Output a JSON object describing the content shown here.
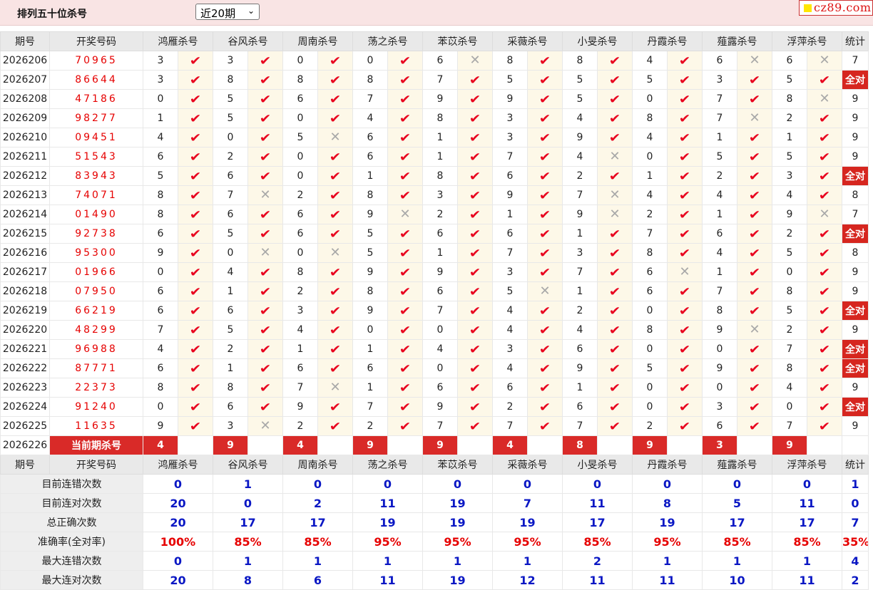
{
  "header": {
    "title": "排列五十位杀号",
    "period_select": "近20期",
    "logo_text": "cz89.com"
  },
  "columns": {
    "period": "期号",
    "draw": "开奖号码",
    "experts": [
      "鸿雁杀号",
      "谷风杀号",
      "周南杀号",
      "荡之杀号",
      "苯苡杀号",
      "采薇杀号",
      "小旻杀号",
      "丹霞杀号",
      "薤露杀号",
      "浮萍杀号"
    ],
    "stat": "统计"
  },
  "rows": [
    {
      "period": "2026206",
      "draw": "70965",
      "picks": [
        [
          3,
          1
        ],
        [
          3,
          1
        ],
        [
          0,
          1
        ],
        [
          0,
          1
        ],
        [
          6,
          0
        ],
        [
          8,
          1
        ],
        [
          8,
          1
        ],
        [
          4,
          1
        ],
        [
          6,
          0
        ],
        [
          6,
          0
        ]
      ],
      "stat": "7"
    },
    {
      "period": "2026207",
      "draw": "86644",
      "picks": [
        [
          3,
          1
        ],
        [
          8,
          1
        ],
        [
          8,
          1
        ],
        [
          8,
          1
        ],
        [
          7,
          1
        ],
        [
          5,
          1
        ],
        [
          5,
          1
        ],
        [
          5,
          1
        ],
        [
          3,
          1
        ],
        [
          5,
          1
        ]
      ],
      "stat": "全对"
    },
    {
      "period": "2026208",
      "draw": "47186",
      "picks": [
        [
          0,
          1
        ],
        [
          5,
          1
        ],
        [
          6,
          1
        ],
        [
          7,
          1
        ],
        [
          9,
          1
        ],
        [
          9,
          1
        ],
        [
          5,
          1
        ],
        [
          0,
          1
        ],
        [
          7,
          1
        ],
        [
          8,
          0
        ]
      ],
      "stat": "9"
    },
    {
      "period": "2026209",
      "draw": "98277",
      "picks": [
        [
          1,
          1
        ],
        [
          5,
          1
        ],
        [
          0,
          1
        ],
        [
          4,
          1
        ],
        [
          8,
          1
        ],
        [
          3,
          1
        ],
        [
          4,
          1
        ],
        [
          8,
          1
        ],
        [
          7,
          0
        ],
        [
          2,
          1
        ]
      ],
      "stat": "9"
    },
    {
      "period": "2026210",
      "draw": "09451",
      "picks": [
        [
          4,
          1
        ],
        [
          0,
          1
        ],
        [
          5,
          0
        ],
        [
          6,
          1
        ],
        [
          1,
          1
        ],
        [
          3,
          1
        ],
        [
          9,
          1
        ],
        [
          4,
          1
        ],
        [
          1,
          1
        ],
        [
          1,
          1
        ]
      ],
      "stat": "9"
    },
    {
      "period": "2026211",
      "draw": "51543",
      "picks": [
        [
          6,
          1
        ],
        [
          2,
          1
        ],
        [
          0,
          1
        ],
        [
          6,
          1
        ],
        [
          1,
          1
        ],
        [
          7,
          1
        ],
        [
          4,
          0
        ],
        [
          0,
          1
        ],
        [
          5,
          1
        ],
        [
          5,
          1
        ]
      ],
      "stat": "9"
    },
    {
      "period": "2026212",
      "draw": "83943",
      "picks": [
        [
          5,
          1
        ],
        [
          6,
          1
        ],
        [
          0,
          1
        ],
        [
          1,
          1
        ],
        [
          8,
          1
        ],
        [
          6,
          1
        ],
        [
          2,
          1
        ],
        [
          1,
          1
        ],
        [
          2,
          1
        ],
        [
          3,
          1
        ]
      ],
      "stat": "全对"
    },
    {
      "period": "2026213",
      "draw": "74071",
      "picks": [
        [
          8,
          1
        ],
        [
          7,
          0
        ],
        [
          2,
          1
        ],
        [
          8,
          1
        ],
        [
          3,
          1
        ],
        [
          9,
          1
        ],
        [
          7,
          0
        ],
        [
          4,
          1
        ],
        [
          4,
          1
        ],
        [
          4,
          1
        ]
      ],
      "stat": "8"
    },
    {
      "period": "2026214",
      "draw": "01490",
      "picks": [
        [
          8,
          1
        ],
        [
          6,
          1
        ],
        [
          6,
          1
        ],
        [
          9,
          0
        ],
        [
          2,
          1
        ],
        [
          1,
          1
        ],
        [
          9,
          0
        ],
        [
          2,
          1
        ],
        [
          1,
          1
        ],
        [
          9,
          0
        ]
      ],
      "stat": "7"
    },
    {
      "period": "2026215",
      "draw": "92738",
      "picks": [
        [
          6,
          1
        ],
        [
          5,
          1
        ],
        [
          6,
          1
        ],
        [
          5,
          1
        ],
        [
          6,
          1
        ],
        [
          6,
          1
        ],
        [
          1,
          1
        ],
        [
          7,
          1
        ],
        [
          6,
          1
        ],
        [
          2,
          1
        ]
      ],
      "stat": "全对"
    },
    {
      "period": "2026216",
      "draw": "95300",
      "picks": [
        [
          9,
          1
        ],
        [
          0,
          0
        ],
        [
          0,
          0
        ],
        [
          5,
          1
        ],
        [
          1,
          1
        ],
        [
          7,
          1
        ],
        [
          3,
          1
        ],
        [
          8,
          1
        ],
        [
          4,
          1
        ],
        [
          5,
          1
        ]
      ],
      "stat": "8"
    },
    {
      "period": "2026217",
      "draw": "01966",
      "picks": [
        [
          0,
          1
        ],
        [
          4,
          1
        ],
        [
          8,
          1
        ],
        [
          9,
          1
        ],
        [
          9,
          1
        ],
        [
          3,
          1
        ],
        [
          7,
          1
        ],
        [
          6,
          0
        ],
        [
          1,
          1
        ],
        [
          0,
          1
        ]
      ],
      "stat": "9"
    },
    {
      "period": "2026218",
      "draw": "07950",
      "picks": [
        [
          6,
          1
        ],
        [
          1,
          1
        ],
        [
          2,
          1
        ],
        [
          8,
          1
        ],
        [
          6,
          1
        ],
        [
          5,
          0
        ],
        [
          1,
          1
        ],
        [
          6,
          1
        ],
        [
          7,
          1
        ],
        [
          8,
          1
        ]
      ],
      "stat": "9"
    },
    {
      "period": "2026219",
      "draw": "66219",
      "picks": [
        [
          6,
          1
        ],
        [
          6,
          1
        ],
        [
          3,
          1
        ],
        [
          9,
          1
        ],
        [
          7,
          1
        ],
        [
          4,
          1
        ],
        [
          2,
          1
        ],
        [
          0,
          1
        ],
        [
          8,
          1
        ],
        [
          5,
          1
        ]
      ],
      "stat": "全对"
    },
    {
      "period": "2026220",
      "draw": "48299",
      "picks": [
        [
          7,
          1
        ],
        [
          5,
          1
        ],
        [
          4,
          1
        ],
        [
          0,
          1
        ],
        [
          0,
          1
        ],
        [
          4,
          1
        ],
        [
          4,
          1
        ],
        [
          8,
          1
        ],
        [
          9,
          0
        ],
        [
          2,
          1
        ]
      ],
      "stat": "9"
    },
    {
      "period": "2026221",
      "draw": "96988",
      "picks": [
        [
          4,
          1
        ],
        [
          2,
          1
        ],
        [
          1,
          1
        ],
        [
          1,
          1
        ],
        [
          4,
          1
        ],
        [
          3,
          1
        ],
        [
          6,
          1
        ],
        [
          0,
          1
        ],
        [
          0,
          1
        ],
        [
          7,
          1
        ]
      ],
      "stat": "全对"
    },
    {
      "period": "2026222",
      "draw": "87771",
      "picks": [
        [
          6,
          1
        ],
        [
          1,
          1
        ],
        [
          6,
          1
        ],
        [
          6,
          1
        ],
        [
          0,
          1
        ],
        [
          4,
          1
        ],
        [
          9,
          1
        ],
        [
          5,
          1
        ],
        [
          9,
          1
        ],
        [
          8,
          1
        ]
      ],
      "stat": "全对"
    },
    {
      "period": "2026223",
      "draw": "22373",
      "picks": [
        [
          8,
          1
        ],
        [
          8,
          1
        ],
        [
          7,
          0
        ],
        [
          1,
          1
        ],
        [
          6,
          1
        ],
        [
          6,
          1
        ],
        [
          1,
          1
        ],
        [
          0,
          1
        ],
        [
          0,
          1
        ],
        [
          4,
          1
        ]
      ],
      "stat": "9"
    },
    {
      "period": "2026224",
      "draw": "91240",
      "picks": [
        [
          0,
          1
        ],
        [
          6,
          1
        ],
        [
          9,
          1
        ],
        [
          7,
          1
        ],
        [
          9,
          1
        ],
        [
          2,
          1
        ],
        [
          6,
          1
        ],
        [
          0,
          1
        ],
        [
          3,
          1
        ],
        [
          0,
          1
        ]
      ],
      "stat": "全对"
    },
    {
      "period": "2026225",
      "draw": "11635",
      "picks": [
        [
          9,
          1
        ],
        [
          3,
          0
        ],
        [
          2,
          1
        ],
        [
          2,
          1
        ],
        [
          7,
          1
        ],
        [
          7,
          1
        ],
        [
          7,
          1
        ],
        [
          2,
          1
        ],
        [
          6,
          1
        ],
        [
          7,
          1
        ]
      ],
      "stat": "9"
    }
  ],
  "current": {
    "period": "2026226",
    "label": "当前期杀号",
    "kills": [
      "4",
      "9",
      "4",
      "9",
      "9",
      "4",
      "8",
      "9",
      "3",
      "9"
    ]
  },
  "summary": [
    {
      "label": "目前连错次数",
      "values": [
        "0",
        "1",
        "0",
        "0",
        "0",
        "0",
        "0",
        "0",
        "0",
        "0"
      ],
      "stat": "1",
      "red": false
    },
    {
      "label": "目前连对次数",
      "values": [
        "20",
        "0",
        "2",
        "11",
        "19",
        "7",
        "11",
        "8",
        "5",
        "11"
      ],
      "stat": "0",
      "red": false
    },
    {
      "label": "总正确次数",
      "values": [
        "20",
        "17",
        "17",
        "19",
        "19",
        "19",
        "17",
        "19",
        "17",
        "17"
      ],
      "stat": "7",
      "red": false
    },
    {
      "label": "准确率(全对率)",
      "values": [
        "100%",
        "85%",
        "85%",
        "95%",
        "95%",
        "95%",
        "85%",
        "95%",
        "85%",
        "85%"
      ],
      "stat": "35%",
      "red": true
    },
    {
      "label": "最大连错次数",
      "values": [
        "0",
        "1",
        "1",
        "1",
        "1",
        "1",
        "2",
        "1",
        "1",
        "1"
      ],
      "stat": "4",
      "red": false
    },
    {
      "label": "最大连对次数",
      "values": [
        "20",
        "8",
        "6",
        "11",
        "19",
        "12",
        "11",
        "11",
        "10",
        "11"
      ],
      "stat": "2",
      "red": false
    }
  ],
  "icons": {
    "correct": "check-icon",
    "wrong": "cross-icon",
    "logo": "yellow-square-icon"
  },
  "colors": {
    "header_bg": "#f9e4e4",
    "accent_red": "#d92a28",
    "draw_red": "#e60000",
    "check_red": "#e8001e",
    "summary_blue": "#0a17c4",
    "mark_bg": "#fdf8e8"
  }
}
